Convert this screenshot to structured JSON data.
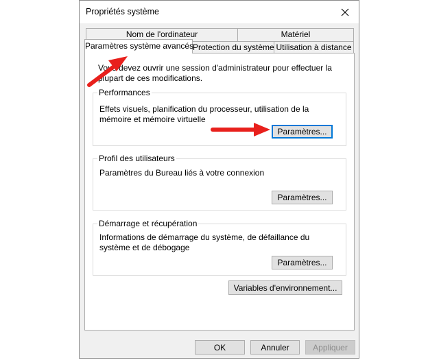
{
  "window": {
    "title": "Propriétés système"
  },
  "tabs": {
    "row1": [
      "Nom de l'ordinateur",
      "Matériel"
    ],
    "row2": [
      "Paramètres système avancés",
      "Protection du système",
      "Utilisation à distance"
    ],
    "active": "Paramètres système avancés"
  },
  "panel": {
    "info": "Vous devez ouvrir une session d'administrateur pour effectuer la plupart de ces modifications.",
    "performances": {
      "legend": "Performances",
      "description": "Effets visuels, planification du processeur, utilisation de la mémoire et mémoire virtuelle",
      "button": "Paramètres..."
    },
    "profil": {
      "legend": "Profil des utilisateurs",
      "description": "Paramètres du Bureau liés à votre connexion",
      "button": "Paramètres..."
    },
    "demarrage": {
      "legend": "Démarrage et récupération",
      "description": "Informations de démarrage du système, de défaillance du système et de débogage",
      "button": "Paramètres..."
    },
    "env_button": "Variables d'environnement..."
  },
  "footer": {
    "ok": "OK",
    "cancel": "Annuler",
    "apply": "Appliquer"
  },
  "colors": {
    "annotation_arrow": "#e8201c",
    "focus_border": "#0078d7"
  }
}
